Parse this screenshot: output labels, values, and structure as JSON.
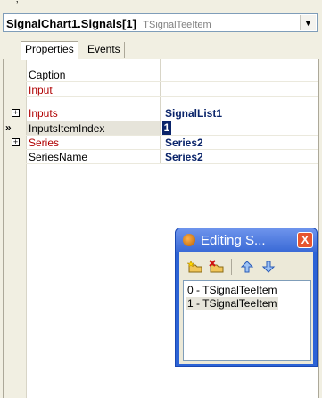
{
  "selector": {
    "object_name": "SignalChart1.Signals[1]",
    "object_type": "TSignalTeeItem"
  },
  "tabs": [
    {
      "label": "Properties",
      "active": true
    },
    {
      "label": "Events",
      "active": false
    }
  ],
  "properties": [
    {
      "name": "Caption",
      "value": "",
      "color": "black",
      "expandable": false
    },
    {
      "name": "Input",
      "value": "",
      "color": "red",
      "expandable": false
    },
    {
      "name": "Inputs",
      "value": "SignalList1",
      "color": "red",
      "expandable": true
    },
    {
      "name": "InputsItemIndex",
      "value": "1",
      "color": "black",
      "expandable": false,
      "selected": true
    },
    {
      "name": "Series",
      "value": "Series2",
      "color": "red",
      "expandable": true
    },
    {
      "name": "SeriesName",
      "value": "Series2",
      "color": "black",
      "expandable": false
    }
  ],
  "editor": {
    "title": "Editing S...",
    "close_label": "X",
    "toolbar_icons": [
      "add-item-icon",
      "delete-item-icon",
      "move-up-icon",
      "move-down-icon"
    ],
    "items": [
      {
        "label": "0 - TSignalTeeItem",
        "selected": false
      },
      {
        "label": "1 - TSignalTeeItem",
        "selected": true
      }
    ]
  },
  "colors": {
    "value_text": "#0a246a",
    "required_property": "#b00000",
    "title_bar": "#3a6ad6"
  }
}
